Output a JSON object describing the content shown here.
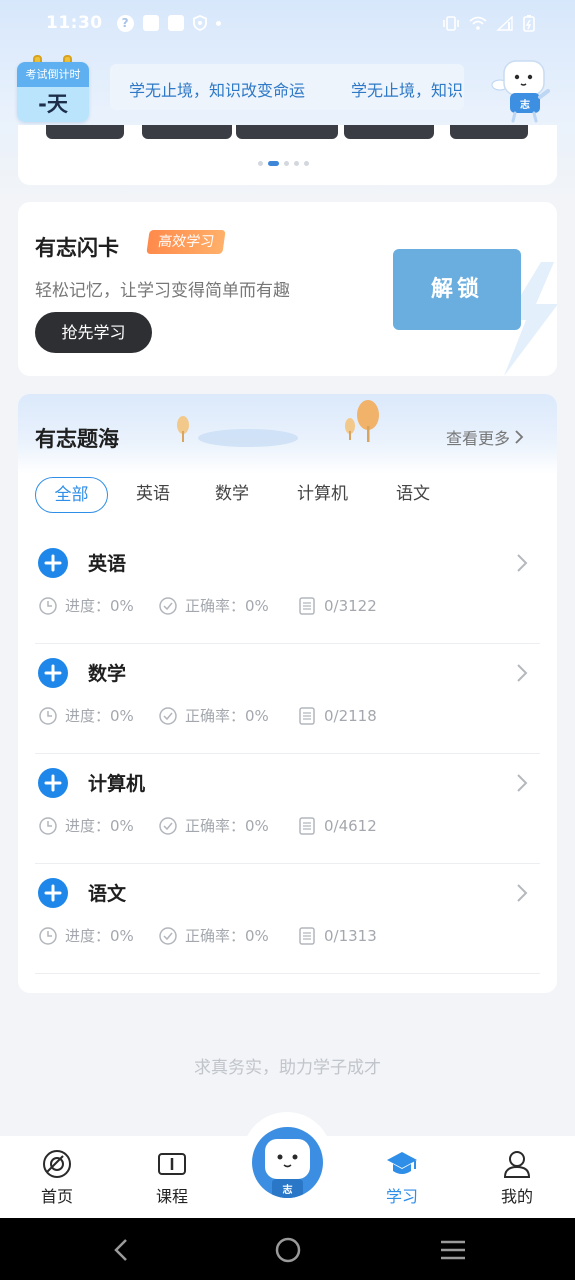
{
  "status_bar": {
    "time": "11:30",
    "left_icons": [
      "help-circle-icon",
      "message-icon",
      "message-icon",
      "shield-icon",
      "dot-icon"
    ],
    "right_icons": [
      "vibrate-icon",
      "wifi-icon",
      "signal-icon",
      "battery-icon"
    ]
  },
  "header": {
    "countdown_label": "考试倒计时",
    "countdown_value": "-天",
    "marquee_text_1": "学无止境，知识改变命运",
    "marquee_text_2": "学无止境，知识改变命运"
  },
  "banner": {
    "page_count": 5,
    "active_page": 2
  },
  "flashcard": {
    "title": "有志闪卡",
    "badge": "高效学习",
    "description": "轻松记忆，让学习变得简单而有趣",
    "start_button": "抢先学习",
    "unlock_button": "解锁"
  },
  "question_bank": {
    "title": "有志题海",
    "more_link": "查看更多",
    "tabs": [
      {
        "label": "全部",
        "active": true
      },
      {
        "label": "英语",
        "active": false
      },
      {
        "label": "数学",
        "active": false
      },
      {
        "label": "计算机",
        "active": false
      },
      {
        "label": "语文",
        "active": false
      }
    ],
    "subjects": [
      {
        "name": "英语",
        "progress": "进度：0%",
        "accuracy": "正确率：0%",
        "count": "0/3122"
      },
      {
        "name": "数学",
        "progress": "进度：0%",
        "accuracy": "正确率：0%",
        "count": "0/2118"
      },
      {
        "name": "计算机",
        "progress": "进度：0%",
        "accuracy": "正确率：0%",
        "count": "0/4612"
      },
      {
        "name": "语文",
        "progress": "进度：0%",
        "accuracy": "正确率：0%",
        "count": "0/1313"
      }
    ]
  },
  "footer_slogan": "求真务实，助力学子成才",
  "bottom_nav": {
    "items": [
      {
        "label": "首页",
        "icon": "home-icon"
      },
      {
        "label": "课程",
        "icon": "book-icon"
      },
      {
        "label": "",
        "icon": "mascot-icon"
      },
      {
        "label": "学习",
        "icon": "graduation-cap-icon",
        "active": true
      },
      {
        "label": "我的",
        "icon": "user-icon"
      }
    ]
  },
  "colors": {
    "accent": "#2f8ee8",
    "unlock": "#6aaee0",
    "dark_button": "#2e2f33",
    "badge": "#ff8a4b"
  }
}
